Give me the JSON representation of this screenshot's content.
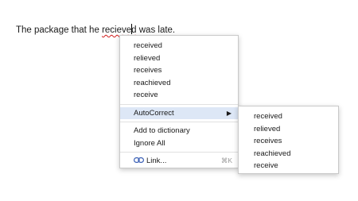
{
  "document": {
    "before": "The package that he ",
    "word_part1": "recieve",
    "word_part2": "d",
    "after": " was late."
  },
  "context_menu": {
    "suggestions": [
      "received",
      "relieved",
      "receives",
      "reachieved",
      "receive"
    ],
    "autocorrect_label": "AutoCorrect",
    "add_to_dictionary": "Add to dictionary",
    "ignore_all": "Ignore All",
    "link_label": "Link...",
    "link_shortcut": "⌘K"
  },
  "submenu": {
    "items": [
      "received",
      "relieved",
      "receives",
      "reachieved",
      "receive"
    ]
  },
  "colors": {
    "highlight": "#dde7f6",
    "misspelling_underline": "#d11a1a",
    "link_icon": "#3a5fb5"
  },
  "icons": {
    "autocorrect_arrow": "triangle-right-icon",
    "link": "link-icon"
  }
}
